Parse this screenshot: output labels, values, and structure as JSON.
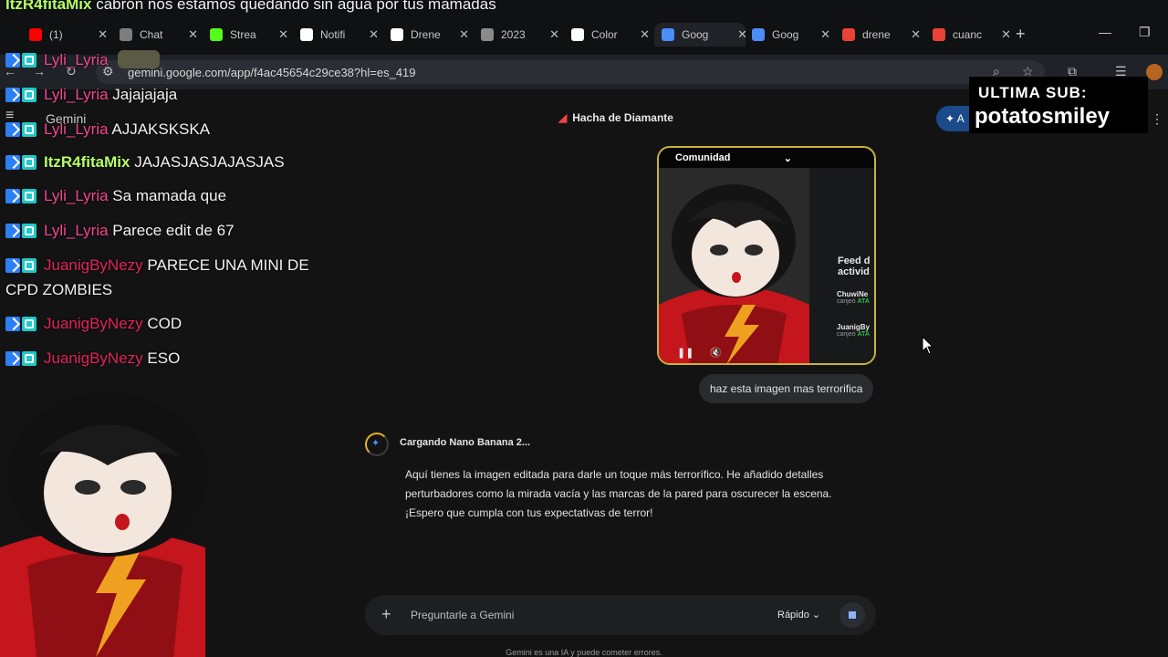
{
  "browser": {
    "tabs": [
      {
        "label": "(1)",
        "icon": "youtube-icon",
        "color": "#ff0000"
      },
      {
        "label": "Chat",
        "icon": "chat-icon",
        "color": "#7d7d7d"
      },
      {
        "label": "Strea",
        "icon": "kick-icon",
        "color": "#53fc18"
      },
      {
        "label": "Notifi",
        "icon": "x-icon",
        "color": "#ffffff"
      },
      {
        "label": "Drene",
        "icon": "tiktok-icon",
        "color": "#ffffff"
      },
      {
        "label": "2023",
        "icon": "globe-icon",
        "color": "#8a8a8a"
      },
      {
        "label": "Color",
        "icon": "chatgpt-icon",
        "color": "#ffffff"
      },
      {
        "label": "Goog",
        "icon": "gemini-icon",
        "color": "#4b8df8",
        "active": true
      },
      {
        "label": "Goog",
        "icon": "gemini-icon",
        "color": "#4b8df8"
      },
      {
        "label": "drene",
        "icon": "google-icon",
        "color": "#ea4335"
      },
      {
        "label": "cuanc",
        "icon": "google-icon",
        "color": "#ea4335"
      }
    ],
    "url": "gemini.google.com/app/f4ac45654c29ce38?hl=es_419"
  },
  "gemini": {
    "app_title": "Gemini",
    "chat_title": "Hacha de Diamante",
    "upgrade_label": "A",
    "image": {
      "top_label": "Comunidad",
      "feed_label": "Feed d\nactivid",
      "feed_users": [
        {
          "name": "ChuwiNe",
          "sub": "canjeó",
          "reward": "ATA"
        },
        {
          "name": "JuanigBy",
          "sub": "canjeó",
          "reward": "ATA"
        }
      ]
    },
    "user_prompt": "haz esta imagen mas terrorifica",
    "loading_text": "Cargando Nano Banana 2...",
    "response_text": "Aquí tienes la imagen editada para darle un toque más terrorífico. He añadido detalles perturbadores como la mirada vacía y las marcas de la pared para oscurecer la escena. ¡Espero que cumpla con tus expectativas de terror!",
    "composer_placeholder": "Preguntarle a Gemini",
    "mode_label": "Rápido",
    "disclaimer": "Gemini es una IA y puede cometer errores."
  },
  "stream_chat": {
    "top_message": {
      "user": "ItzR4fitaMix",
      "text": "cabrón nos estamos quedando sin agua por tus mamadas"
    },
    "messages": [
      {
        "user": "Lyli_Lyria",
        "text": "",
        "color": "pink",
        "emote": true
      },
      {
        "user": "Lyli_Lyria",
        "text": "Jajajajaja",
        "color": "pink"
      },
      {
        "user": "Lyli_Lyria",
        "text": "AJJAKSKSKA",
        "color": "pink"
      },
      {
        "user": "ItzR4fitaMix",
        "text": "JAJASJASJAJASJAS",
        "color": "green"
      },
      {
        "user": "Lyli_Lyria",
        "text": "Sa mamada que",
        "color": "pink"
      },
      {
        "user": "Lyli_Lyria",
        "text": "Parece edit de 67",
        "color": "pink"
      },
      {
        "user": "JuanigByNezy",
        "text": "PARECE UNA MINI DE",
        "text2": "CPD ZOMBIES",
        "color": "red"
      },
      {
        "user": "JuanigByNezy",
        "text": "COD",
        "color": "red"
      },
      {
        "user": "JuanigByNezy",
        "text": "ESO",
        "color": "red"
      }
    ]
  },
  "overlay": {
    "last_sub_label": "ULTIMA SUB:",
    "last_sub_name": "potatosmiley"
  }
}
